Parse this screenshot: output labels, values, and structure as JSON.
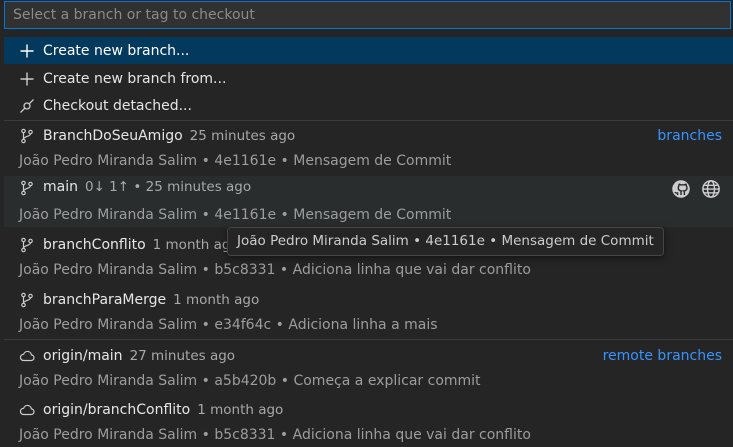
{
  "search": {
    "placeholder": "Select a branch or tag to checkout",
    "value": ""
  },
  "actions": [
    {
      "label": "Create new branch...",
      "icon": "plus-icon"
    },
    {
      "label": "Create new branch from...",
      "icon": "plus-icon"
    },
    {
      "label": "Checkout detached...",
      "icon": "git-commit-icon"
    }
  ],
  "groups": {
    "branches": "branches",
    "remote_branches": "remote branches"
  },
  "branches": [
    {
      "name": "BranchDoSeuAmigo",
      "desc": "25 minutes ago",
      "detail": "João Pedro Miranda Salim • 4e1161e • Mensagem de Commit"
    },
    {
      "name": "main",
      "desc": "0↓ 1↑ • 25 minutes ago",
      "detail": "João Pedro Miranda Salim • 4e1161e • Mensagem de Commit"
    },
    {
      "name": "branchConflito",
      "desc": "1 month ago",
      "detail": "João Pedro Miranda Salim • b5c8331 • Adiciona linha que vai dar conflito"
    },
    {
      "name": "branchParaMerge",
      "desc": "1 month ago",
      "detail": "João Pedro Miranda Salim • e34f64c • Adiciona linha a mais"
    }
  ],
  "remote_branches": [
    {
      "name": "origin/main",
      "desc": "27 minutes ago",
      "detail": "João Pedro Miranda Salim • a5b420b • Começa a explicar commit"
    },
    {
      "name": "origin/branchConflito",
      "desc": "1 month ago",
      "detail": "João Pedro Miranda Salim • b5c8331 • Adiciona linha que vai dar conflito"
    }
  ],
  "tooltip": "João Pedro Miranda Salim • 4e1161e • Mensagem de Commit",
  "colors": {
    "accent": "#0078d4",
    "selection": "#04395e",
    "link": "#3794ff"
  }
}
